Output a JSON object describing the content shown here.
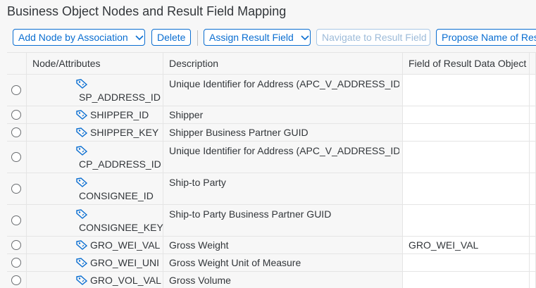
{
  "page": {
    "title": "Business Object Nodes and Result Field Mapping"
  },
  "toolbar": {
    "add_node": "Add Node by Association",
    "delete": "Delete",
    "assign_result_field": "Assign Result Field",
    "navigate": "Navigate to Result Field",
    "propose": "Propose Name of Res"
  },
  "table": {
    "columns": [
      "Node/Attributes",
      "Description",
      "Field of Result Data Object"
    ],
    "rows": [
      {
        "name": "SP_ADDRESS_ID",
        "description": "Unique Identifier for Address (APC_V_ADDRESS_ID)",
        "field": ""
      },
      {
        "name": "SHIPPER_ID",
        "description": "Shipper",
        "field": ""
      },
      {
        "name": "SHIPPER_KEY",
        "description": "Shipper Business Partner GUID",
        "field": ""
      },
      {
        "name": "CP_ADDRESS_ID",
        "description": "Unique Identifier for Address (APC_V_ADDRESS_ID)",
        "field": ""
      },
      {
        "name": "CONSIGNEE_ID",
        "description": "Ship-to Party",
        "field": ""
      },
      {
        "name": "CONSIGNEE_KEY",
        "description": "Ship-to Party Business Partner GUID",
        "field": ""
      },
      {
        "name": "GRO_WEI_VAL",
        "description": "Gross Weight",
        "field": "GRO_WEI_VAL"
      },
      {
        "name": "GRO_WEI_UNI",
        "description": "Gross Weight Unit of Measure",
        "field": ""
      },
      {
        "name": "GRO_VOL_VAL",
        "description": "Gross Volume",
        "field": ""
      }
    ]
  },
  "colors": {
    "accent": "#0a6ed1",
    "disabled": "#9dbbd9",
    "border": "#e5e5e5",
    "text": "#32363a"
  },
  "icons": {
    "attribute": "attribute-tag-icon",
    "dropdown": "chevron-down-icon",
    "select": "radio-button"
  }
}
